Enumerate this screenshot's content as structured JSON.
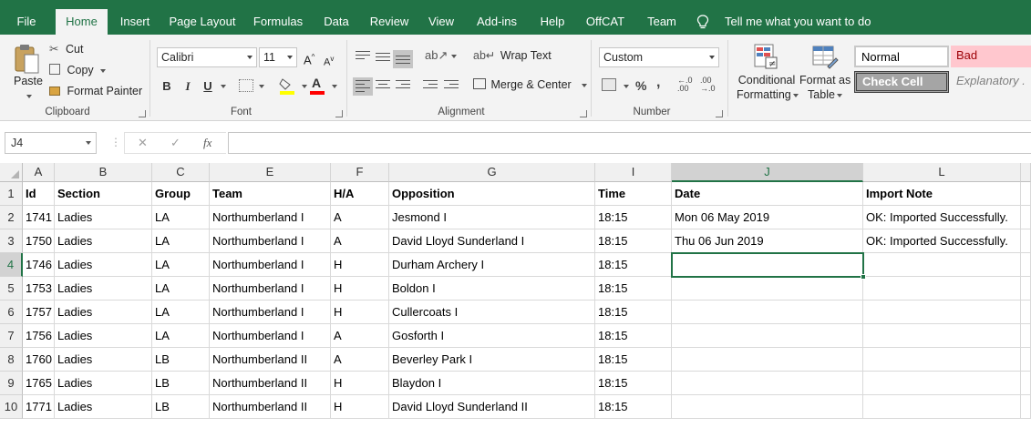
{
  "ribbon_tabs": [
    {
      "label": "File"
    },
    {
      "label": "Home"
    },
    {
      "label": "Insert"
    },
    {
      "label": "Page Layout"
    },
    {
      "label": "Formulas"
    },
    {
      "label": "Data"
    },
    {
      "label": "Review"
    },
    {
      "label": "View"
    },
    {
      "label": "Add-ins"
    },
    {
      "label": "Help"
    },
    {
      "label": "OffCAT"
    },
    {
      "label": "Team"
    }
  ],
  "active_tab": "Home",
  "tell_me": "Tell me what you want to do",
  "clipboard": {
    "paste": "Paste",
    "cut": "Cut",
    "copy": "Copy",
    "format_painter": "Format Painter",
    "group_label": "Clipboard"
  },
  "font": {
    "name": "Calibri",
    "size": "11",
    "grow": "A",
    "shrink": "A",
    "bold": "B",
    "italic": "I",
    "underline": "U",
    "color_glyph": "A",
    "group_label": "Font"
  },
  "alignment": {
    "wrap_text": "Wrap Text",
    "merge_center": "Merge & Center",
    "group_label": "Alignment"
  },
  "number": {
    "format": "Custom",
    "percent": "%",
    "comma": ",",
    "group_label": "Number"
  },
  "styles": {
    "conditional_formatting": [
      "Conditional",
      "Formatting"
    ],
    "format_as_table": [
      "Format as",
      "Table"
    ],
    "normal": "Normal",
    "bad": "Bad",
    "check_cell": "Check Cell",
    "explanatory": "Explanatory ."
  },
  "formula_bar": {
    "name_box": "J4",
    "cancel": "✕",
    "enter": "✓",
    "fx": "fx",
    "value": ""
  },
  "columns": [
    "A",
    "B",
    "C",
    "E",
    "F",
    "G",
    "I",
    "J",
    "L"
  ],
  "selected_column": "J",
  "selected_row": "4",
  "headers": [
    "Id",
    "Section",
    "Group",
    "Team",
    "H/A",
    "Opposition",
    "Time",
    "Date",
    "Import Note"
  ],
  "rows": [
    {
      "row": "1"
    },
    {
      "row": "2",
      "cells": [
        "1741",
        "Ladies",
        "LA",
        "Northumberland I",
        "A",
        "Jesmond I",
        "18:15",
        "Mon 06 May 2019",
        "OK: Imported Successfully."
      ]
    },
    {
      "row": "3",
      "cells": [
        "1750",
        "Ladies",
        "LA",
        "Northumberland I",
        "A",
        "David Lloyd Sunderland I",
        "18:15",
        "Thu 06 Jun 2019",
        "OK: Imported Successfully."
      ]
    },
    {
      "row": "4",
      "cells": [
        "1746",
        "Ladies",
        "LA",
        "Northumberland I",
        "H",
        "Durham Archery I",
        "18:15",
        "",
        ""
      ]
    },
    {
      "row": "5",
      "cells": [
        "1753",
        "Ladies",
        "LA",
        "Northumberland I",
        "H",
        "Boldon I",
        "18:15",
        "",
        ""
      ]
    },
    {
      "row": "6",
      "cells": [
        "1757",
        "Ladies",
        "LA",
        "Northumberland I",
        "H",
        "Cullercoats I",
        "18:15",
        "",
        ""
      ]
    },
    {
      "row": "7",
      "cells": [
        "1756",
        "Ladies",
        "LA",
        "Northumberland I",
        "A",
        "Gosforth I",
        "18:15",
        "",
        ""
      ]
    },
    {
      "row": "8",
      "cells": [
        "1760",
        "Ladies",
        "LB",
        "Northumberland II",
        "A",
        "Beverley Park I",
        "18:15",
        "",
        ""
      ]
    },
    {
      "row": "9",
      "cells": [
        "1765",
        "Ladies",
        "LB",
        "Northumberland II",
        "H",
        "Blaydon I",
        "18:15",
        "",
        ""
      ]
    },
    {
      "row": "10",
      "cells": [
        "1771",
        "Ladies",
        "LB",
        "Northumberland II",
        "H",
        "David Lloyd Sunderland II",
        "18:15",
        "",
        ""
      ]
    }
  ],
  "colors": {
    "brand_green": "#217346",
    "bad_fill": "#ffc7ce",
    "bad_text": "#9c0006",
    "check_fill": "#a5a5a5"
  }
}
